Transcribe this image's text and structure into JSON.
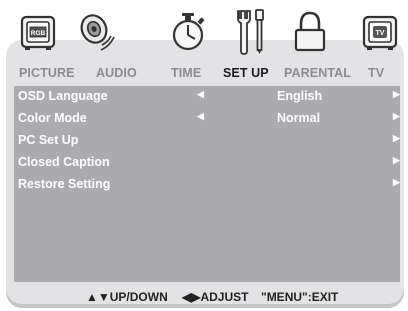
{
  "tabs": [
    {
      "label": "PICTURE",
      "icon": "picture-icon",
      "active": false
    },
    {
      "label": "AUDIO",
      "icon": "audio-icon",
      "active": false
    },
    {
      "label": "TIME",
      "icon": "timer-icon",
      "active": false
    },
    {
      "label": "SET UP",
      "icon": "tools-icon",
      "active": true
    },
    {
      "label": "PARENTAL",
      "icon": "lock-icon",
      "active": false
    },
    {
      "label": "TV",
      "icon": "tv-icon",
      "active": false
    }
  ],
  "rows": [
    {
      "label": "OSD Language",
      "left_arrow": "◀",
      "value": "English",
      "right_arrow": "▶"
    },
    {
      "label": "Color Mode",
      "left_arrow": "◀",
      "value": "Normal",
      "right_arrow": "▶"
    },
    {
      "label": "PC Set Up",
      "left_arrow": "",
      "value": "",
      "right_arrow": "▶"
    },
    {
      "label": "Closed Caption",
      "left_arrow": "",
      "value": "",
      "right_arrow": "▶"
    },
    {
      "label": "Restore Setting",
      "left_arrow": "",
      "value": "",
      "right_arrow": "▶"
    }
  ],
  "footer": {
    "updown": "▲▼UP/DOWN",
    "adjust": "◀▶ADJUST",
    "exit": "\"MENU\":EXIT"
  },
  "colors": {
    "panel": "#e3e3e5",
    "content": "#abaaaf",
    "active_tab": "#1d1d1f",
    "inactive_tab": "#8b8b8d"
  },
  "icon_labels": {
    "picture_badge": "RGB",
    "tv_badge": "TV"
  }
}
